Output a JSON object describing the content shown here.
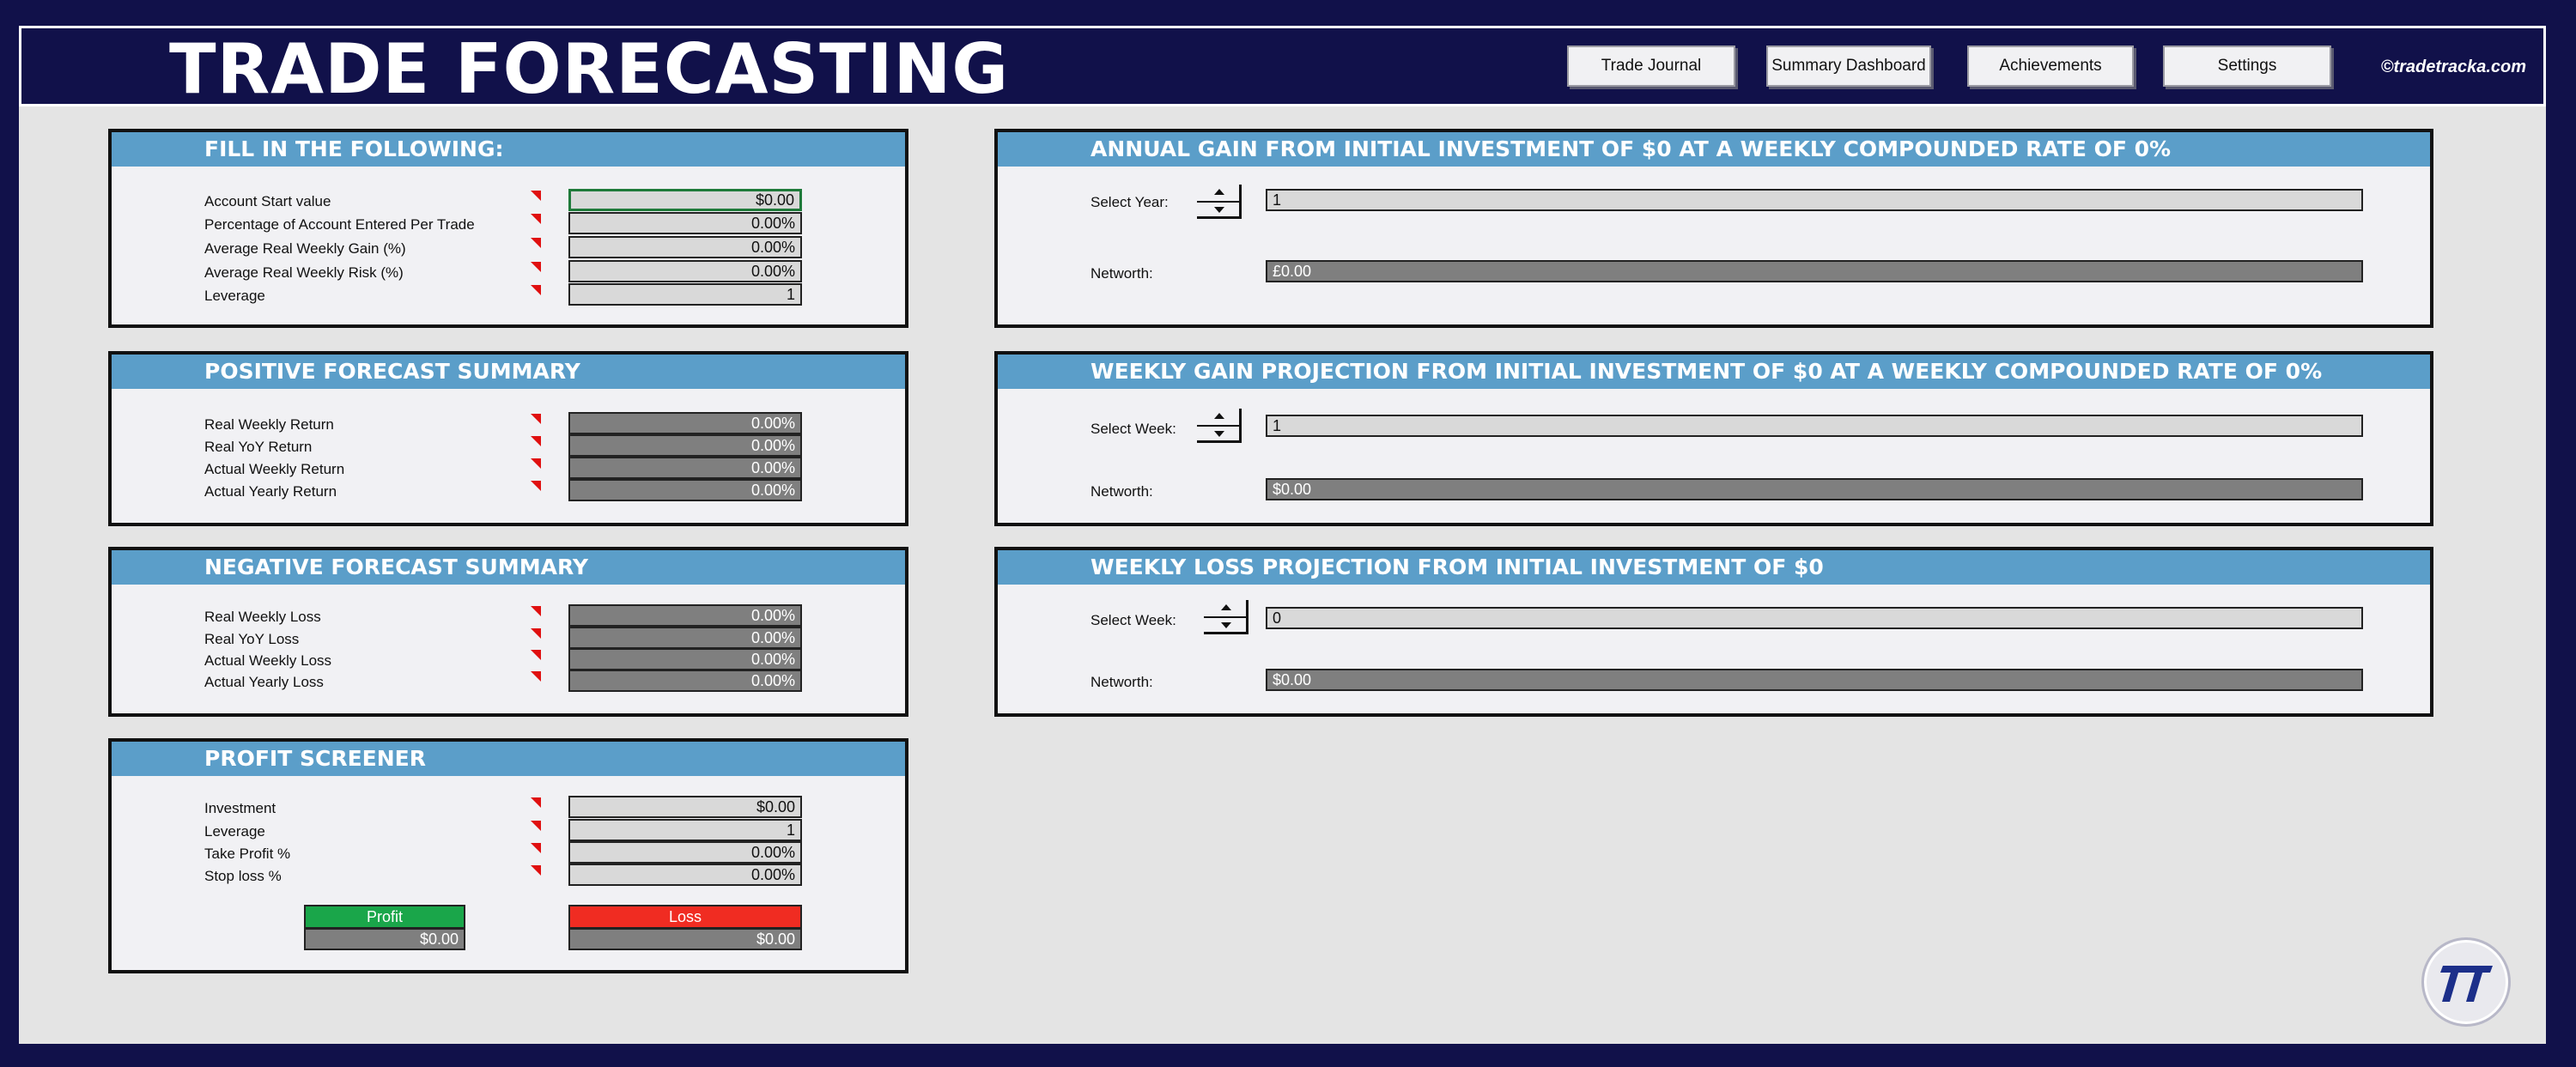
{
  "header": {
    "title": "TRADE FORECASTING",
    "nav": [
      {
        "label": "Trade Journal"
      },
      {
        "label": "Summary Dashboard"
      },
      {
        "label": "Achievements"
      },
      {
        "label": "Settings"
      }
    ],
    "copyright": "©tradetracka.com"
  },
  "fill_in": {
    "title": "FILL IN THE FOLLOWING:",
    "rows": [
      {
        "label": "Account Start value",
        "value": "$0.00"
      },
      {
        "label": "Percentage of Account Entered Per Trade",
        "value": "0.00%"
      },
      {
        "label": "Average Real Weekly Gain (%)",
        "value": "0.00%"
      },
      {
        "label": "Average Real Weekly Risk (%)",
        "value": "0.00%"
      },
      {
        "label": "Leverage",
        "value": "1"
      }
    ]
  },
  "positive": {
    "title": "POSITIVE FORECAST SUMMARY",
    "rows": [
      {
        "label": "Real Weekly Return",
        "value": "0.00%"
      },
      {
        "label": "Real YoY Return",
        "value": "0.00%"
      },
      {
        "label": "Actual Weekly Return",
        "value": "0.00%"
      },
      {
        "label": "Actual Yearly Return",
        "value": "0.00%"
      }
    ]
  },
  "negative": {
    "title": "NEGATIVE FORECAST SUMMARY",
    "rows": [
      {
        "label": "Real Weekly Loss",
        "value": "0.00%"
      },
      {
        "label": "Real YoY Loss",
        "value": "0.00%"
      },
      {
        "label": "Actual Weekly Loss",
        "value": "0.00%"
      },
      {
        "label": "Actual Yearly Loss",
        "value": "0.00%"
      }
    ]
  },
  "screener": {
    "title": "PROFIT SCREENER",
    "rows": [
      {
        "label": "Investment",
        "value": "$0.00"
      },
      {
        "label": "Leverage",
        "value": "1"
      },
      {
        "label": "Take Profit %",
        "value": "0.00%"
      },
      {
        "label": "Stop loss %",
        "value": "0.00%"
      }
    ],
    "profit_label": "Profit",
    "profit_value": "$0.00",
    "loss_label": "Loss",
    "loss_value": "$0.00"
  },
  "annual": {
    "title": "ANNUAL GAIN FROM INITIAL INVESTMENT OF $0 AT A WEEKLY COMPOUNDED RATE OF 0%",
    "select_label": "Select Year:",
    "select_value": "1",
    "networth_label": "Networth:",
    "networth_value": "£0.00"
  },
  "weekly_gain": {
    "title": "WEEKLY GAIN PROJECTION FROM INITIAL INVESTMENT OF $0 AT A WEEKLY COMPOUNDED RATE OF 0%",
    "select_label": "Select Week:",
    "select_value": "1",
    "networth_label": "Networth:",
    "networth_value": "$0.00"
  },
  "weekly_loss": {
    "title": "WEEKLY LOSS PROJECTION FROM INITIAL INVESTMENT OF $0",
    "select_label": "Select Week:",
    "select_value": "0",
    "networth_label": "Networth:",
    "networth_value": "$0.00"
  },
  "colors": {
    "background": "#11114a",
    "panel_header": "#5b9ec9",
    "profit": "#1aa64a",
    "loss": "#f02c22",
    "input_cell": "#d9d9d9",
    "output_cell": "#7f7f7f"
  }
}
